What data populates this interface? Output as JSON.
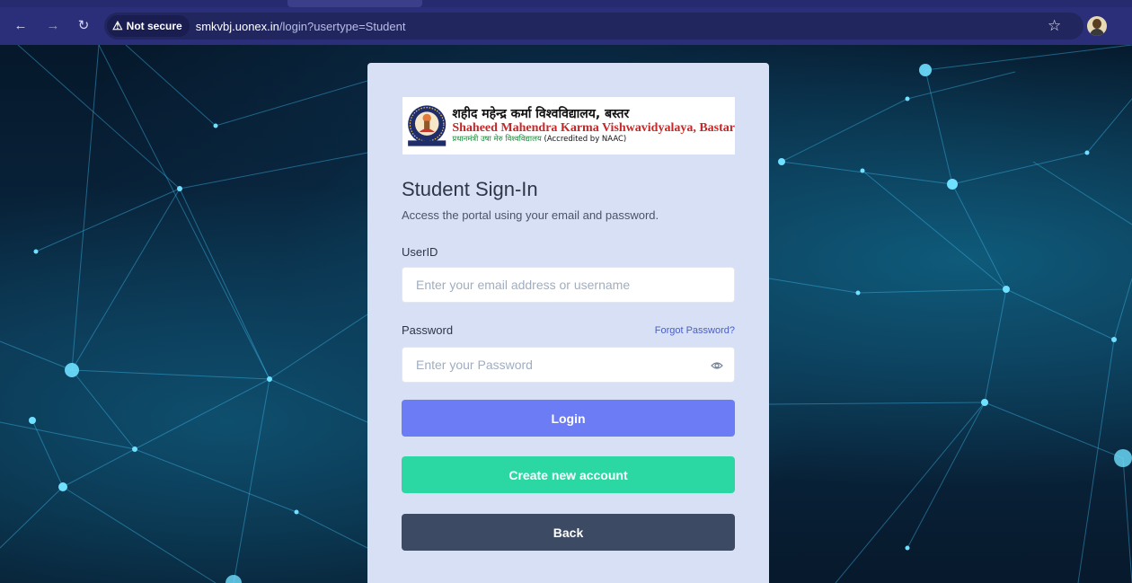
{
  "browser": {
    "security_label": "Not secure",
    "url_host": "smkvbj.uonex.in",
    "url_path": "/login?usertype=Student"
  },
  "university": {
    "name_hindi": "शहीद महेन्द्र कर्मा विश्वविद्यालय, बस्तर",
    "name_english": "Shaheed Mahendra Karma Vishwavidyalaya, Bastar",
    "tagline_hindi": "प्रधानमंत्री उषा मेरु विश्वविद्यालय",
    "tagline_english": "(Accredited by NAAC)"
  },
  "login": {
    "title": "Student Sign-In",
    "subtitle": "Access the portal using your email and password.",
    "userid_label": "UserID",
    "userid_placeholder": "Enter your email address or username",
    "password_label": "Password",
    "forgot_password": "Forgot Password?",
    "password_placeholder": "Enter your Password",
    "login_button": "Login",
    "create_button": "Create new account",
    "back_button": "Back"
  },
  "colors": {
    "login": "#6b7cf5",
    "create": "#2bd8a3",
    "back": "#3c4a63",
    "card": "#d8e0f5"
  }
}
